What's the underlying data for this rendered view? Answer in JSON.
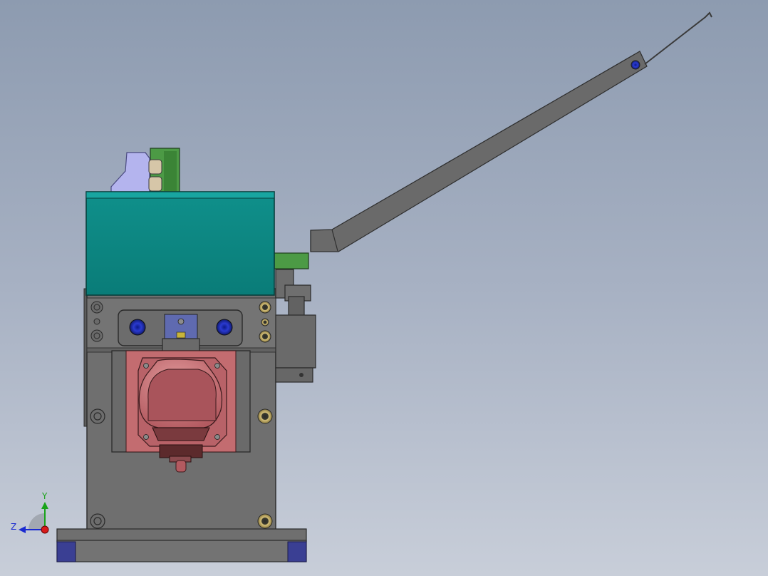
{
  "triad": {
    "y_label": "Y",
    "z_label": "Z"
  },
  "colors": {
    "background_top": "#8d9bb0",
    "background_bottom": "#c8ced9",
    "body": "#6f6f6f",
    "teal_cover": "#0b8580",
    "pink_part": "#c36c70",
    "green_bracket": "#4c9a45",
    "lavender_block": "#b4b4ee",
    "navy_pads": "#3a3f93",
    "screw_blue": "#1f2fb4"
  }
}
